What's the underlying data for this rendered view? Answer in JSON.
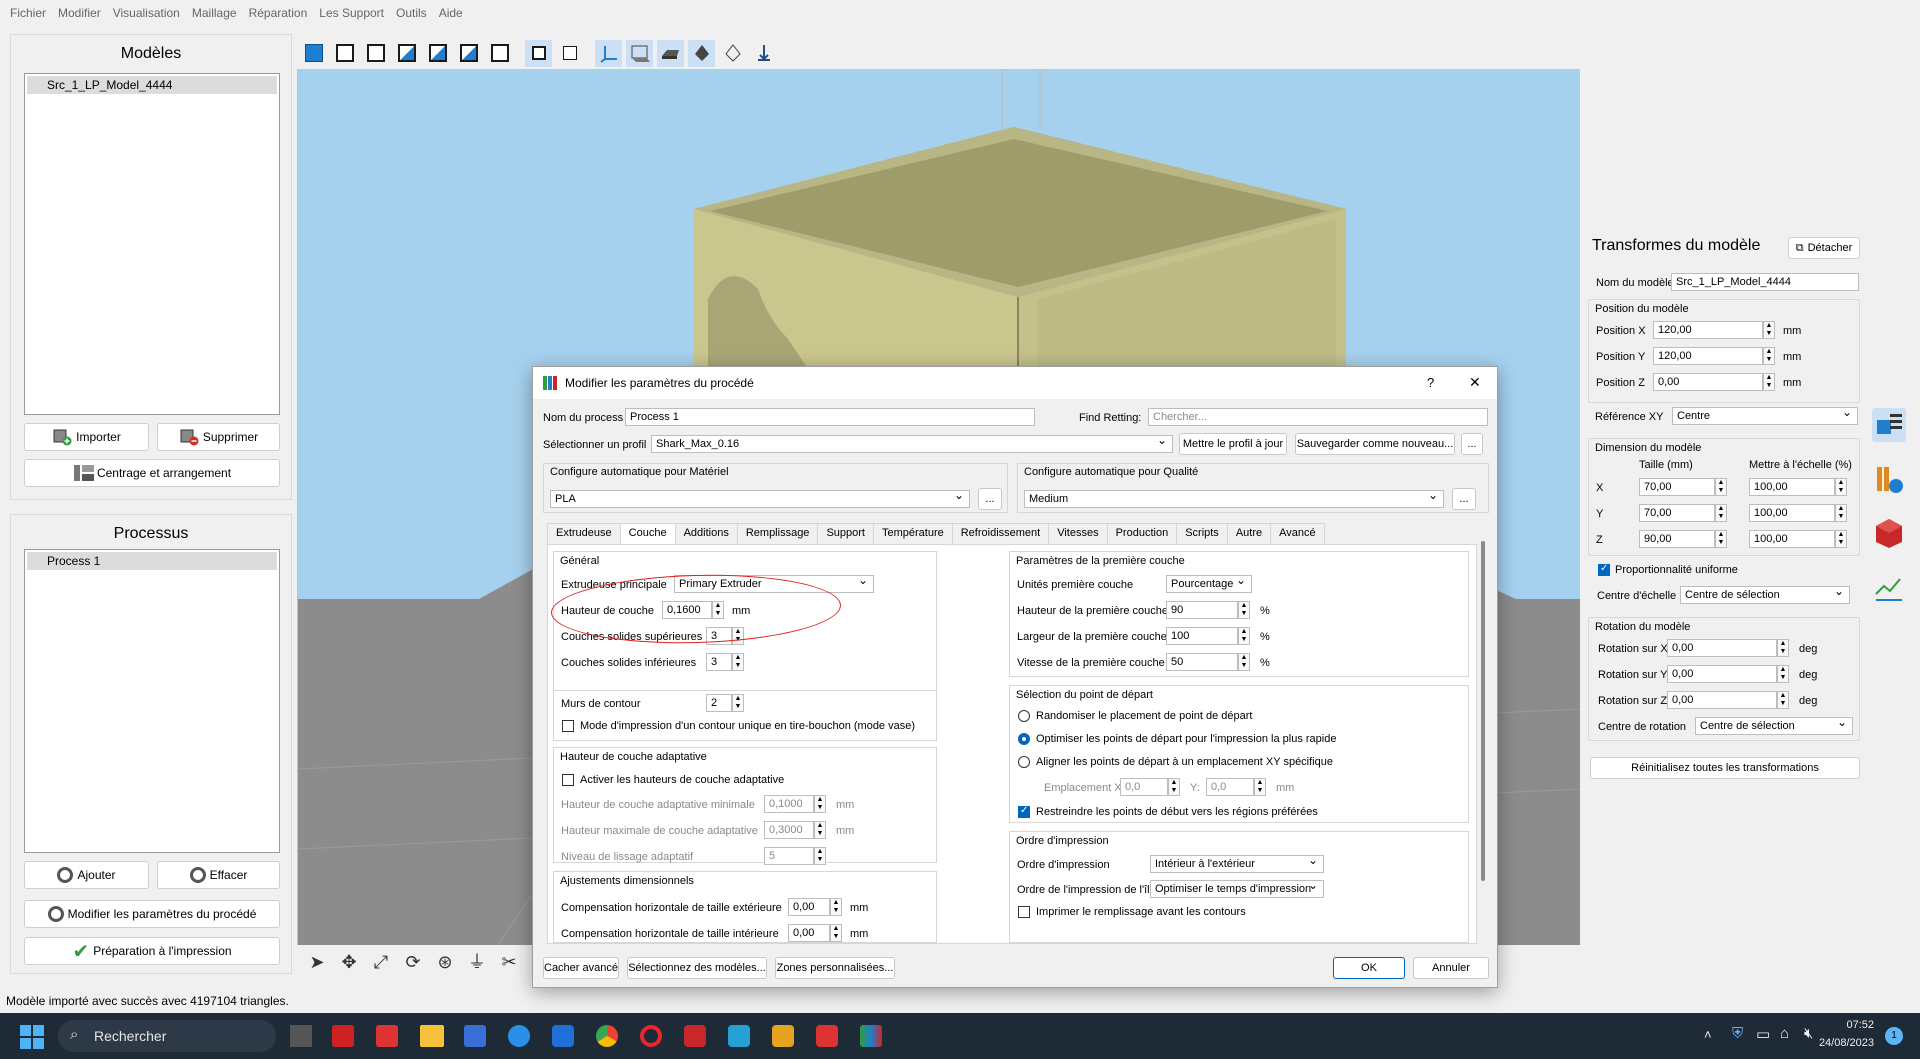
{
  "menu": [
    "Fichier",
    "Modifier",
    "Visualisation",
    "Maillage",
    "Réparation",
    "Les Support",
    "Outils",
    "Aide"
  ],
  "models_panel": {
    "title": "Modèles",
    "items": [
      "Src_1_LP_Model_4444"
    ],
    "import_label": "Importer",
    "delete_label": "Supprimer",
    "arrange_label": "Centrage et arrangement"
  },
  "process_panel": {
    "title": "Processus",
    "items": [
      "Process 1"
    ],
    "add_label": "Ajouter",
    "erase_label": "Effacer",
    "edit_label": "Modifier les paramètres du procédé",
    "prepare_label": "Préparation à l'impression"
  },
  "right_panel": {
    "title": "Transformes du modèle",
    "detach_label": "Détacher",
    "name_label": "Nom du modèle:",
    "name_value": "Src_1_LP_Model_4444",
    "position": {
      "title": "Position du modèle",
      "x_label": "Position X",
      "x_value": "120,00",
      "y_label": "Position Y",
      "y_value": "120,00",
      "z_label": "Position Z",
      "z_value": "0,00",
      "unit": "mm",
      "ref_label": "Référence XY",
      "ref_value": "Centre"
    },
    "dimension": {
      "title": "Dimension du modèle",
      "size_header": "Taille (mm)",
      "scale_header": "Mettre à l'échelle (%)",
      "x_label": "X",
      "x_size": "70,00",
      "x_scale": "100,00",
      "y_label": "Y",
      "y_size": "70,00",
      "y_scale": "100,00",
      "z_label": "Z",
      "z_size": "90,00",
      "z_scale": "100,00",
      "uniform_label": "Proportionnalité uniforme",
      "scale_center_label": "Centre d'échelle",
      "scale_center_value": "Centre de sélection"
    },
    "rotation": {
      "title": "Rotation du modèle",
      "x_label": "Rotation sur X",
      "x_value": "0,00",
      "y_label": "Rotation sur Y",
      "y_value": "0,00",
      "z_label": "Rotation sur Z",
      "z_value": "0,00",
      "unit": "deg",
      "center_label": "Centre de rotation",
      "center_value": "Centre de sélection"
    },
    "reset_label": "Réinitialisez toutes les transformations"
  },
  "dialog": {
    "title": "Modifier les paramètres du procédé",
    "help": "?",
    "close": "✕",
    "process_name_label": "Nom du process",
    "process_name_value": "Process 1",
    "find_label": "Find Retting:",
    "find_placeholder": "Chercher...",
    "profile_label": "Sélectionner un profil",
    "profile_value": "Shark_Max_0.16",
    "update_profile_label": "Mettre le profil à jour",
    "save_new_label": "Sauvegarder comme nouveau...",
    "more": "...",
    "material_title": "Configure automatique pour Matériel",
    "material_value": "PLA",
    "quality_title": "Configure automatique pour Qualité",
    "quality_value": "Medium",
    "tabs": [
      "Extrudeuse",
      "Couche",
      "Additions",
      "Remplissage",
      "Support",
      "Température",
      "Refroidissement",
      "Vitesses",
      "Production",
      "Scripts",
      "Autre",
      "Avancé"
    ],
    "general": {
      "title": "Général",
      "extruder_label": "Extrudeuse principale",
      "extruder_value": "Primary Extruder",
      "layer_height_label": "Hauteur de couche",
      "layer_height_value": "0,1600",
      "mm": "mm",
      "top_label": "Couches solides supérieures",
      "top_value": "3",
      "bottom_label": "Couches solides inférieures",
      "bottom_value": "3",
      "walls_label": "Murs de contour",
      "walls_value": "2",
      "vase_label": "Mode d'impression d'un contour unique en tire-bouchon (mode vase)"
    },
    "adaptive": {
      "title": "Hauteur de couche adaptative",
      "enable_label": "Activer les hauteurs de couche adaptative",
      "min_label": "Hauteur de couche adaptative minimale",
      "min_value": "0,1000",
      "max_label": "Hauteur maximale de couche adaptative",
      "max_value": "0,3000",
      "smooth_label": "Niveau de lissage adaptatif",
      "smooth_value": "5",
      "mm": "mm"
    },
    "dimensional": {
      "title": "Ajustements dimensionnels",
      "outer_label": "Compensation horizontale de taille extérieure",
      "outer_value": "0,00",
      "inner_label": "Compensation horizontale de taille intérieure",
      "inner_value": "0,00",
      "mm": "mm"
    },
    "first_layer": {
      "title": "Paramètres de la première couche",
      "units_label": "Unités première couche",
      "units_value": "Pourcentage",
      "height_label": "Hauteur de la première couche",
      "height_value": "90",
      "width_label": "Largeur de la première couche",
      "width_value": "100",
      "speed_label": "Vitesse de la première couche",
      "speed_value": "50",
      "pct": "%"
    },
    "start_point": {
      "title": "Sélection du point de départ",
      "opt1": "Randomiser le placement de point de départ",
      "opt2": "Optimiser les points de départ pour l'impression la plus rapide",
      "opt3": "Aligner les points de départ à un emplacement XY spécifique",
      "loc_label": "Emplacement X:",
      "loc_x": "0,0",
      "loc_y_label": "Y:",
      "loc_y": "0,0",
      "mm": "mm",
      "restrict_label": "Restreindre les points de début vers les régions préférées"
    },
    "order": {
      "title": "Ordre d'impression",
      "order_label": "Ordre d'impression",
      "order_value": "Intérieur à l'extérieur",
      "island_label": "Ordre de l'impression de l'île",
      "island_value": "Optimiser le temps d'impression",
      "infill_label": "Imprimer le remplissage avant les contours"
    },
    "footer": {
      "hide_label": "Cacher avancé",
      "select_models_label": "Sélectionnez des modèles...",
      "zones_label": "Zones personnalisées...",
      "ok_label": "OK",
      "cancel_label": "Annuler"
    }
  },
  "status_text": "Modèle importé avec succès avec 4197104 triangles.",
  "taskbar": {
    "search_label": "Rechercher",
    "time": "07:52",
    "date": "24/08/2023",
    "notif_count": "1"
  },
  "colors": {
    "accent": "#0067c0",
    "viewport_sky": "#a6d1ee",
    "floor": "#8c8c8c",
    "model": "#c9c68e",
    "annotation": "#e02020",
    "taskbar": "#1f2a37"
  }
}
